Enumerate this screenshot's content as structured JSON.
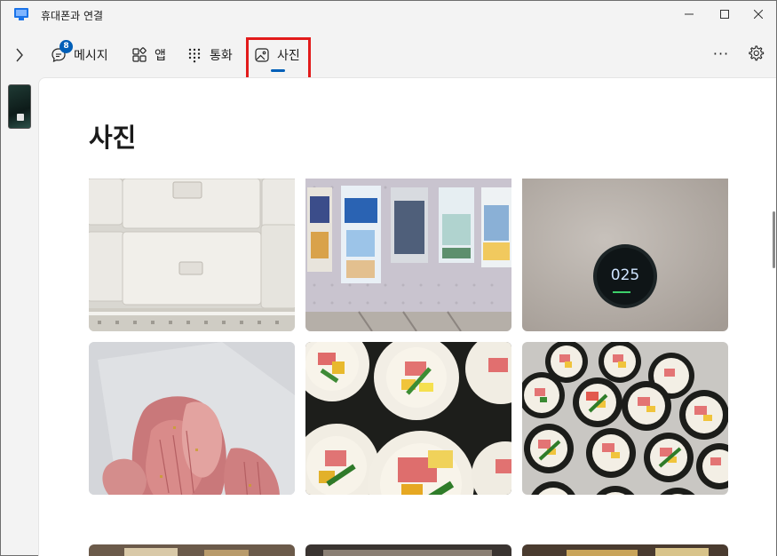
{
  "window": {
    "title": "휴대폰과 연결"
  },
  "nav": {
    "messages_label": "메시지",
    "messages_badge": "8",
    "apps_label": "앱",
    "calls_label": "통화",
    "photos_label": "사진",
    "selected_tab": "사진",
    "more_label": "···"
  },
  "page": {
    "title": "사진"
  },
  "photos": [
    {
      "subject": "white storage drawers"
    },
    {
      "subject": "stationery packets on display rack"
    },
    {
      "subject": "smart device display",
      "display_text": "025"
    },
    {
      "subject": "pink fruit in plastic bag"
    },
    {
      "subject": "kimbap slices"
    },
    {
      "subject": "kimbap platter"
    }
  ],
  "colors": {
    "accent": "#005fb8",
    "highlight": "#e21b1b",
    "window_bg": "#f3f3f3",
    "content_bg": "#ffffff"
  }
}
